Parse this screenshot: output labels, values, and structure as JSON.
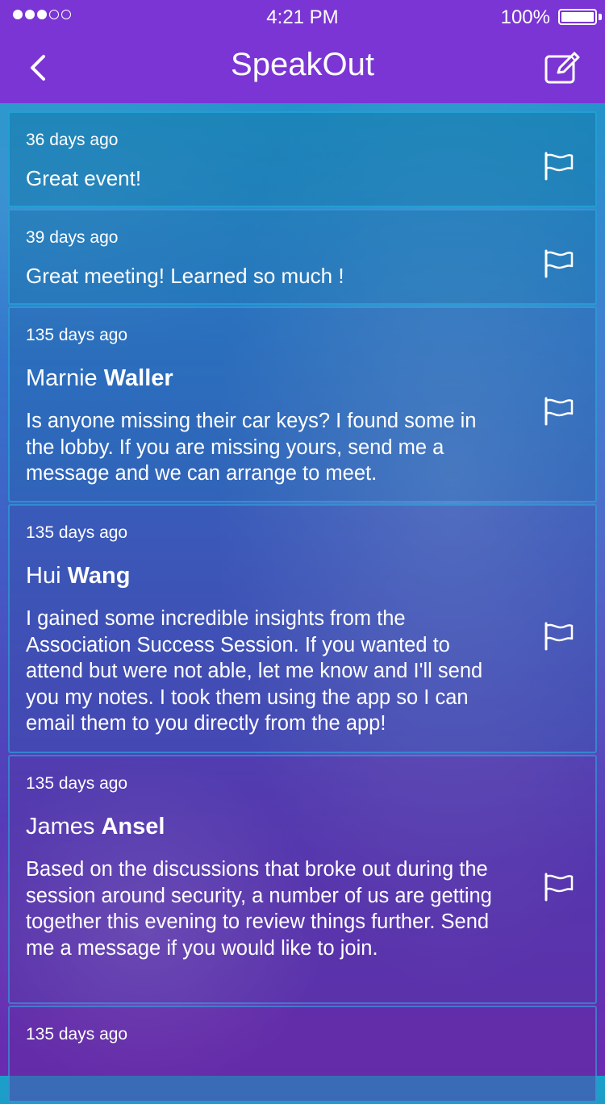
{
  "status_bar": {
    "time": "4:21 PM",
    "battery": "100%",
    "signal_dots": [
      "full",
      "full",
      "full",
      "empty",
      "empty"
    ]
  },
  "nav": {
    "title": "SpeakOut",
    "back_icon": "chevron-left-icon",
    "compose_icon": "compose-icon"
  },
  "colors": {
    "header": "#7a35d4",
    "accent_border": "#28b4e6"
  },
  "posts": [
    {
      "timestamp": "36 days ago",
      "message": "Great event!"
    },
    {
      "timestamp": "39 days ago",
      "message": "Great meeting! Learned so much !"
    },
    {
      "timestamp": "135 days ago",
      "first_name": "Marnie",
      "last_name": "Waller",
      "message": "Is anyone missing their car keys? I found some in the lobby. If you are missing yours, send me a message and we can arrange to meet."
    },
    {
      "timestamp": "135 days ago",
      "first_name": "Hui",
      "last_name": "Wang",
      "message": "I gained some incredible insights from the Association Success Session. If you wanted to attend but were not able, let me know and I'll send you my notes. I took them using the app so I can email them to you directly from the app!"
    },
    {
      "timestamp": "135 days ago",
      "first_name": "James",
      "last_name": "Ansel",
      "message": "Based on the discussions that broke out during the session around security, a number of us are getting together this evening to review things further. Send me a message if you would like to join."
    },
    {
      "timestamp": "135 days ago"
    }
  ]
}
